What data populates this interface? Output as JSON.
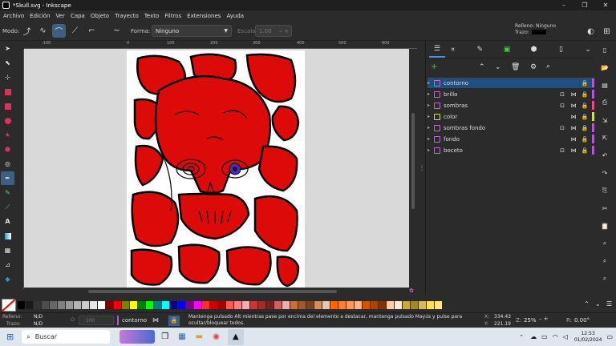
{
  "window": {
    "title": "*Skull.svg - Inkscape",
    "minimize": "–",
    "maximize": "❐",
    "close": "✕"
  },
  "menu": [
    "Archivo",
    "Edición",
    "Ver",
    "Capa",
    "Objeto",
    "Trayecto",
    "Texto",
    "Filtros",
    "Extensiones",
    "Ayuda"
  ],
  "toolctrl": {
    "modo_label": "Modo:",
    "forma_label": "Forma:",
    "forma_value": "Ninguno",
    "escala_label": "Escala:",
    "escala_value": "1.00",
    "relleno_label": "Relleno:",
    "relleno_value": "Ninguno",
    "trazo_label": "Trazo:"
  },
  "ruler_top": [
    "-100",
    "0",
    "100",
    "200",
    "300",
    "400",
    "500",
    "600"
  ],
  "layers": [
    {
      "name": "contorno",
      "selected": true,
      "color": "#b05ad0"
    },
    {
      "name": "brillo",
      "selected": false,
      "color": "#b05ad0"
    },
    {
      "name": "sombras",
      "selected": false,
      "color": "#e64a8a"
    },
    {
      "name": "color",
      "selected": false,
      "color": "#c8e05a"
    },
    {
      "name": "sombras fondo",
      "selected": false,
      "color": "#b05ad0"
    },
    {
      "name": "fondo",
      "selected": false,
      "color": "#b05ad0"
    },
    {
      "name": "boceto",
      "selected": false,
      "color": "#b05ad0"
    }
  ],
  "status": {
    "relleno_label": "Relleno:",
    "relleno_value": "N/D",
    "trazo_label": "Trazo:",
    "trazo_value": "N/D",
    "opacity_label": "O:",
    "opacity_value": "100",
    "layer_name": "contorno",
    "message": "Mantenga pulsado Alt mientras pase por encima del elemento a destacar, mantenga pulsado Mayús y pulse para ocultar/bloquear todos.",
    "x_label": "X:",
    "x_value": "334.43",
    "y_label": "Y:",
    "y_value": "221.19",
    "z_label": "Z:",
    "zoom_value": "25%",
    "r_label": "R:",
    "rotation_value": "0.00°"
  },
  "taskbar": {
    "search_placeholder": "Buscar",
    "time": "12:53",
    "date": "01/02/2024"
  },
  "colors": {
    "skull_red": "#dd0a0a",
    "selection_blue": "#1e4f80",
    "canvas_bg": "#d9d9d9"
  }
}
